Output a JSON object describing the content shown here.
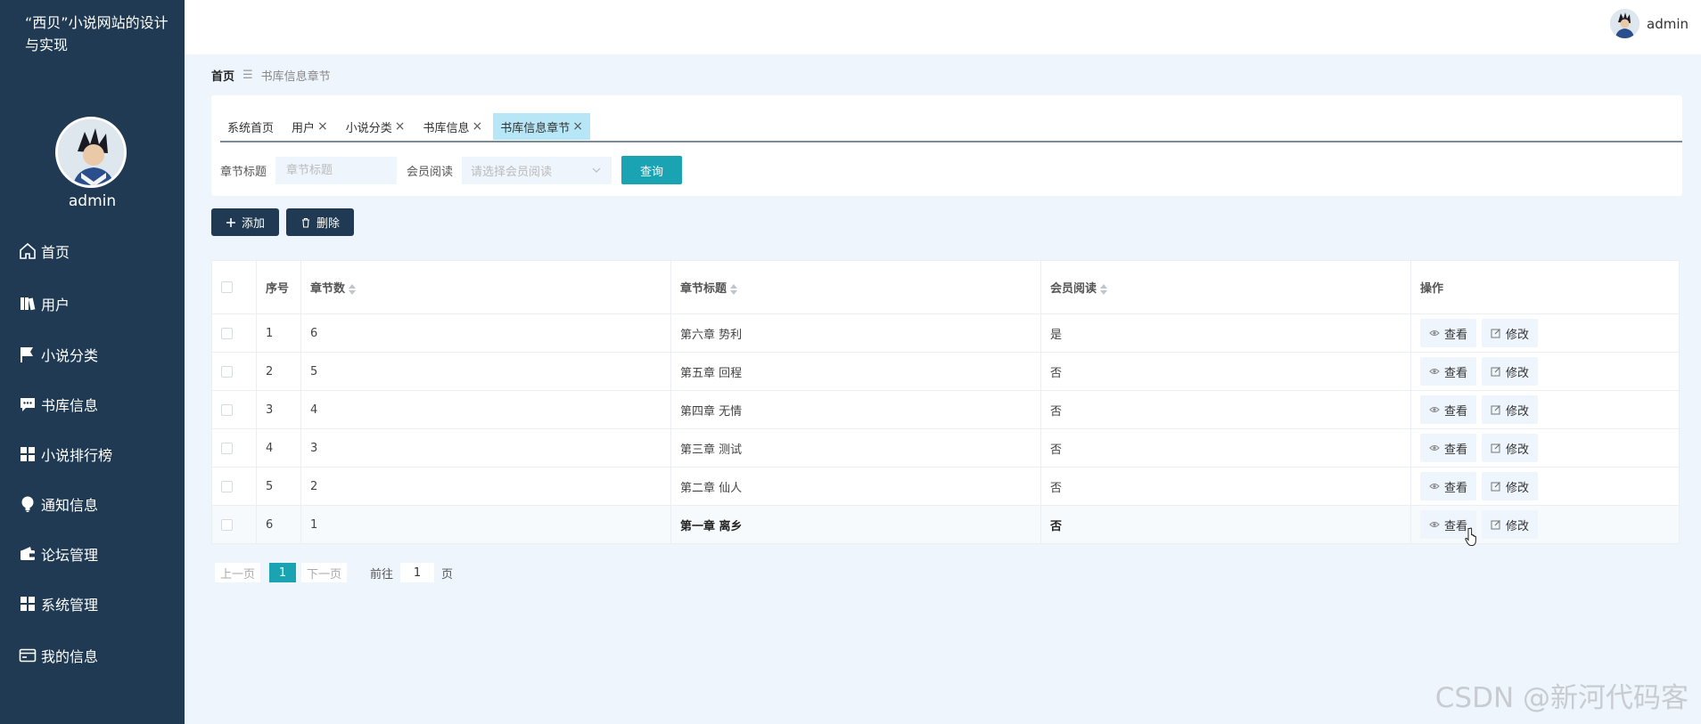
{
  "sidebar": {
    "site_title": "“西贝”小说网站的设计与实现",
    "username": "admin",
    "menu": [
      {
        "label": "首页",
        "icon": "home-icon"
      },
      {
        "label": "用户",
        "icon": "user-book-icon"
      },
      {
        "label": "小说分类",
        "icon": "flag-icon"
      },
      {
        "label": "书库信息",
        "icon": "chat-bubble-icon"
      },
      {
        "label": "小说排行榜",
        "icon": "grid-icon"
      },
      {
        "label": "通知信息",
        "icon": "lightbulb-icon"
      },
      {
        "label": "论坛管理",
        "icon": "wallet-icon"
      },
      {
        "label": "系统管理",
        "icon": "grid-icon"
      },
      {
        "label": "我的信息",
        "icon": "card-icon"
      }
    ]
  },
  "header": {
    "username": "admin"
  },
  "breadcrumb": {
    "home": "首页",
    "current": "书库信息章节"
  },
  "tabs": [
    {
      "label": "系统首页",
      "closable": false,
      "active": false
    },
    {
      "label": "用户",
      "closable": true,
      "active": false
    },
    {
      "label": "小说分类",
      "closable": true,
      "active": false
    },
    {
      "label": "书库信息",
      "closable": true,
      "active": false
    },
    {
      "label": "书库信息章节",
      "closable": true,
      "active": true
    }
  ],
  "filter": {
    "chapter_title_label": "章节标题",
    "chapter_title_placeholder": "章节标题",
    "member_read_label": "会员阅读",
    "member_read_placeholder": "请选择会员阅读",
    "query_label": "查询"
  },
  "actions": {
    "add_label": "添加",
    "delete_label": "删除"
  },
  "table": {
    "headers": {
      "index": "序号",
      "chapter_num": "章节数",
      "chapter_title": "章节标题",
      "member_read": "会员阅读",
      "operation": "操作"
    },
    "view_label": "查看",
    "edit_label": "修改",
    "rows": [
      {
        "index": "1",
        "chapter_num": "6",
        "chapter_title": "第六章 势利",
        "member_read": "是"
      },
      {
        "index": "2",
        "chapter_num": "5",
        "chapter_title": "第五章 回程",
        "member_read": "否"
      },
      {
        "index": "3",
        "chapter_num": "4",
        "chapter_title": "第四章 无情",
        "member_read": "否"
      },
      {
        "index": "4",
        "chapter_num": "3",
        "chapter_title": "第三章 测试",
        "member_read": "否"
      },
      {
        "index": "5",
        "chapter_num": "2",
        "chapter_title": "第二章 仙人",
        "member_read": "否"
      },
      {
        "index": "6",
        "chapter_num": "1",
        "chapter_title": "第一章 离乡",
        "member_read": "否"
      }
    ]
  },
  "pagination": {
    "prev": "上一页",
    "current": "1",
    "next": "下一页",
    "goto": "前往",
    "goto_value": "1",
    "unit": "页"
  },
  "watermark": "CSDN @新河代码客",
  "colors": {
    "sidebar": "#1f3a52",
    "accent": "#19a3b3",
    "active_tab": "#b7e7f6",
    "page_bg": "#eef5fc"
  }
}
